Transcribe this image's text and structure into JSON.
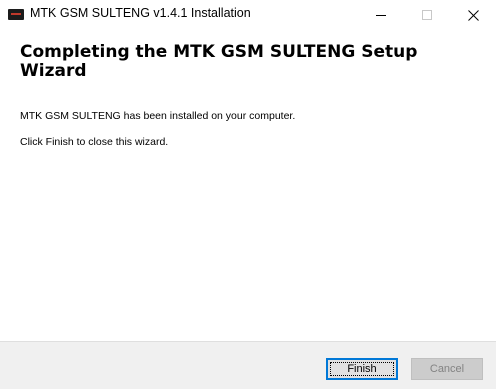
{
  "window": {
    "title": "MTK GSM SULTENG v1.4.1 Installation"
  },
  "icons": {
    "app": "app-icon",
    "minimize": "minimize-icon",
    "maximize": "maximize-icon",
    "close": "close-icon"
  },
  "content": {
    "heading": "Completing the MTK GSM SULTENG Setup Wizard",
    "installed_message": "MTK GSM SULTENG has been installed on your computer.",
    "finish_instruction": "Click Finish to close this wizard."
  },
  "buttons": {
    "finish_label": "Finish",
    "cancel_label": "Cancel",
    "cancel_enabled": false
  },
  "colors": {
    "accent": "#0078d7",
    "button_bar": "#f0f0f0",
    "disabled_text": "#838383"
  }
}
